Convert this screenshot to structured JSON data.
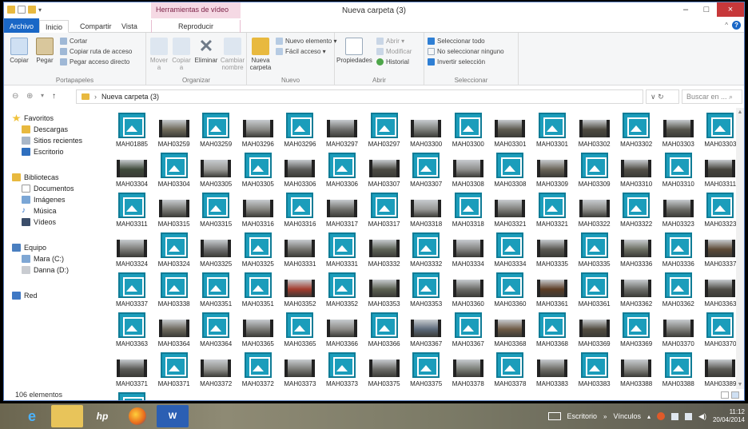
{
  "window": {
    "title": "Nueva carpeta (3)",
    "context_tab_group": "Herramientas de vídeo",
    "controls": {
      "minimize": "–",
      "maximize": "□",
      "close": "×"
    }
  },
  "tabs": [
    "Archivo",
    "Inicio",
    "Compartir",
    "Vista",
    "Reproducir"
  ],
  "ribbon": {
    "portapapeles": {
      "label": "Portapapeles",
      "copiar": "Copiar",
      "pegar": "Pegar",
      "cortar": "Cortar",
      "copiar_ruta": "Copiar ruta de acceso",
      "pegar_acceso": "Pegar acceso directo"
    },
    "organizar": {
      "label": "Organizar",
      "mover": "Mover a",
      "copiar": "Copiar a",
      "eliminar": "Eliminar",
      "cambiar": "Cambiar nombre"
    },
    "nuevo": {
      "label": "Nuevo",
      "nueva_carpeta": "Nueva carpeta",
      "nuevo_elemento": "Nuevo elemento ▾",
      "facil_acceso": "Fácil acceso ▾"
    },
    "abrir": {
      "label": "Abrir",
      "propiedades": "Propiedades",
      "abrir": "Abrir ▾",
      "modificar": "Modificar",
      "historial": "Historial"
    },
    "seleccionar": {
      "label": "Seleccionar",
      "todo": "Seleccionar todo",
      "ninguno": "No seleccionar ninguno",
      "invertir": "Invertir selección"
    }
  },
  "address": {
    "path": "Nueva carpeta (3)",
    "refresh": "∨ ↻",
    "search_placeholder": "Buscar en ... ⌕"
  },
  "nav": {
    "favoritos": "Favoritos",
    "descargas": "Descargas",
    "sitios_recientes": "Sitios recientes",
    "escritorio": "Escritorio",
    "bibliotecas": "Bibliotecas",
    "documentos": "Documentos",
    "imagenes": "Imágenes",
    "musica": "Música",
    "videos": "Vídeos",
    "equipo": "Equipo",
    "mara": "Mara (C:)",
    "danna": "Danna (D:)",
    "red": "Red"
  },
  "files": [
    {
      "name": "MAH01885",
      "kind": "icon"
    },
    {
      "name": "MAH03259",
      "kind": "video",
      "tint": "#6f6a5a"
    },
    {
      "name": "MAH03259",
      "kind": "icon"
    },
    {
      "name": "MAH03296",
      "kind": "video",
      "tint": "#8a8a86"
    },
    {
      "name": "MAH03296",
      "kind": "icon"
    },
    {
      "name": "MAH03297",
      "kind": "video",
      "tint": "#6e6e6c"
    },
    {
      "name": "MAH03297",
      "kind": "icon"
    },
    {
      "name": "MAH03300",
      "kind": "video",
      "tint": "#7d7f7b"
    },
    {
      "name": "MAH03300",
      "kind": "icon"
    },
    {
      "name": "MAH03301",
      "kind": "video",
      "tint": "#5d5a4f"
    },
    {
      "name": "MAH03301",
      "kind": "icon"
    },
    {
      "name": "MAH03302",
      "kind": "video",
      "tint": "#4e4a40"
    },
    {
      "name": "MAH03302",
      "kind": "icon"
    },
    {
      "name": "MAH03303",
      "kind": "video",
      "tint": "#56554c"
    },
    {
      "name": "MAH03303",
      "kind": "icon"
    },
    {
      "name": "MAH03304",
      "kind": "video",
      "tint": "#3f4a3a"
    },
    {
      "name": "MAH03304",
      "kind": "icon"
    },
    {
      "name": "MAH03305",
      "kind": "video",
      "tint": "#9a9a96"
    },
    {
      "name": "MAH03305",
      "kind": "icon"
    },
    {
      "name": "MAH03306",
      "kind": "video",
      "tint": "#5b5b58"
    },
    {
      "name": "MAH03306",
      "kind": "icon"
    },
    {
      "name": "MAH03307",
      "kind": "video",
      "tint": "#4c4b44"
    },
    {
      "name": "MAH03307",
      "kind": "icon"
    },
    {
      "name": "MAH03308",
      "kind": "video",
      "tint": "#8f8f8d"
    },
    {
      "name": "MAH03308",
      "kind": "icon"
    },
    {
      "name": "MAH03309",
      "kind": "video",
      "tint": "#6a6558"
    },
    {
      "name": "MAH03309",
      "kind": "icon"
    },
    {
      "name": "MAH03310",
      "kind": "video",
      "tint": "#535048"
    },
    {
      "name": "MAH03310",
      "kind": "icon"
    },
    {
      "name": "MAH03311",
      "kind": "video",
      "tint": "#46443d"
    },
    {
      "name": "MAH03311",
      "kind": "icon"
    },
    {
      "name": "MAH03315",
      "kind": "video",
      "tint": "#7a7a76"
    },
    {
      "name": "MAH03315",
      "kind": "icon"
    },
    {
      "name": "MAH03316",
      "kind": "video",
      "tint": "#85847f"
    },
    {
      "name": "MAH03316",
      "kind": "icon"
    },
    {
      "name": "MAH03317",
      "kind": "video",
      "tint": "#6f6f6b"
    },
    {
      "name": "MAH03317",
      "kind": "icon"
    },
    {
      "name": "MAH03318",
      "kind": "video",
      "tint": "#989896"
    },
    {
      "name": "MAH03318",
      "kind": "icon"
    },
    {
      "name": "MAH03321",
      "kind": "video",
      "tint": "#7e7e7a"
    },
    {
      "name": "MAH03321",
      "kind": "icon"
    },
    {
      "name": "MAH03322",
      "kind": "video",
      "tint": "#8c8c88"
    },
    {
      "name": "MAH03322",
      "kind": "icon"
    },
    {
      "name": "MAH03323",
      "kind": "video",
      "tint": "#6b6b66"
    },
    {
      "name": "MAH03323",
      "kind": "icon"
    },
    {
      "name": "MAH03324",
      "kind": "video",
      "tint": "#7b7b77"
    },
    {
      "name": "MAH03324",
      "kind": "icon"
    },
    {
      "name": "MAH03325",
      "kind": "video",
      "tint": "#707070"
    },
    {
      "name": "MAH03325",
      "kind": "icon"
    },
    {
      "name": "MAH03331",
      "kind": "video",
      "tint": "#74736e"
    },
    {
      "name": "MAH03331",
      "kind": "icon"
    },
    {
      "name": "MAH03332",
      "kind": "video",
      "tint": "#5f6458"
    },
    {
      "name": "MAH03332",
      "kind": "icon"
    },
    {
      "name": "MAH03334",
      "kind": "video",
      "tint": "#828280"
    },
    {
      "name": "MAH03334",
      "kind": "icon"
    },
    {
      "name": "MAH03335",
      "kind": "video",
      "tint": "#5a5852"
    },
    {
      "name": "MAH03335",
      "kind": "icon"
    },
    {
      "name": "MAH03336",
      "kind": "video",
      "tint": "#6c6f63"
    },
    {
      "name": "MAH03336",
      "kind": "icon"
    },
    {
      "name": "MAH03337",
      "kind": "video",
      "tint": "#5d4a36"
    },
    {
      "name": "MAH03337",
      "kind": "icon"
    },
    {
      "name": "MAH03338",
      "kind": "icon"
    },
    {
      "name": "MAH03351",
      "kind": "icon"
    },
    {
      "name": "MAH03351",
      "kind": "icon"
    },
    {
      "name": "MAH03352",
      "kind": "video",
      "tint": "#a33b2c"
    },
    {
      "name": "MAH03352",
      "kind": "icon"
    },
    {
      "name": "MAH03353",
      "kind": "video",
      "tint": "#5c6152"
    },
    {
      "name": "MAH03353",
      "kind": "icon"
    },
    {
      "name": "MAH03360",
      "kind": "video",
      "tint": "#6a6a66"
    },
    {
      "name": "MAH03360",
      "kind": "icon"
    },
    {
      "name": "MAH03361",
      "kind": "video",
      "tint": "#5c3c24"
    },
    {
      "name": "MAH03361",
      "kind": "icon"
    },
    {
      "name": "MAH03362",
      "kind": "video",
      "tint": "#6d6e6a"
    },
    {
      "name": "MAH03362",
      "kind": "icon"
    },
    {
      "name": "MAH03363",
      "kind": "video",
      "tint": "#4f4d47"
    },
    {
      "name": "MAH03363",
      "kind": "icon"
    },
    {
      "name": "MAH03364",
      "kind": "video",
      "tint": "#6e6a5e"
    },
    {
      "name": "MAH03364",
      "kind": "icon"
    },
    {
      "name": "MAH03365",
      "kind": "video",
      "tint": "#7a7a76"
    },
    {
      "name": "MAH03365",
      "kind": "icon"
    },
    {
      "name": "MAH03366",
      "kind": "video",
      "tint": "#8b8a86"
    },
    {
      "name": "MAH03366",
      "kind": "icon"
    },
    {
      "name": "MAH03367",
      "kind": "video",
      "tint": "#5c6a7a"
    },
    {
      "name": "MAH03367",
      "kind": "icon"
    },
    {
      "name": "MAH03368",
      "kind": "video",
      "tint": "#6e5a45"
    },
    {
      "name": "MAH03368",
      "kind": "icon"
    },
    {
      "name": "MAH03369",
      "kind": "video",
      "tint": "#524c40"
    },
    {
      "name": "MAH03369",
      "kind": "icon"
    },
    {
      "name": "MAH03370",
      "kind": "video",
      "tint": "#7c7c78"
    },
    {
      "name": "MAH03370",
      "kind": "icon"
    },
    {
      "name": "MAH03371",
      "kind": "video",
      "tint": "#5a5a56"
    },
    {
      "name": "MAH03371",
      "kind": "icon"
    },
    {
      "name": "MAH03372",
      "kind": "video",
      "tint": "#8f8f8b"
    },
    {
      "name": "MAH03372",
      "kind": "icon"
    },
    {
      "name": "MAH03373",
      "kind": "video",
      "tint": "#7b7b77"
    },
    {
      "name": "MAH03373",
      "kind": "icon"
    },
    {
      "name": "MAH03375",
      "kind": "video",
      "tint": "#6c6c68"
    },
    {
      "name": "MAH03375",
      "kind": "icon"
    },
    {
      "name": "MAH03378",
      "kind": "video",
      "tint": "#7a7d76"
    },
    {
      "name": "MAH03378",
      "kind": "icon"
    },
    {
      "name": "MAH03383",
      "kind": "video",
      "tint": "#6f6e68"
    },
    {
      "name": "MAH03383",
      "kind": "icon"
    },
    {
      "name": "MAH03388",
      "kind": "video",
      "tint": "#858580"
    },
    {
      "name": "MAH03388",
      "kind": "icon"
    },
    {
      "name": "MAH03389",
      "kind": "video",
      "tint": "#5a5954"
    },
    {
      "name": "",
      "kind": "icon"
    }
  ],
  "status": {
    "count": "106 elementos"
  },
  "taskbar": {
    "apps": [
      "e",
      "",
      "hp",
      "",
      "W"
    ],
    "tray": {
      "escritorio": "Escritorio",
      "vinculos": "Vínculos",
      "time": "11:12",
      "date": "20/04/2014"
    }
  },
  "colors": {
    "accent": "#1a67c6",
    "icon": "#1b9dbb",
    "context": "#f5d9e4",
    "close": "#c7383a"
  }
}
